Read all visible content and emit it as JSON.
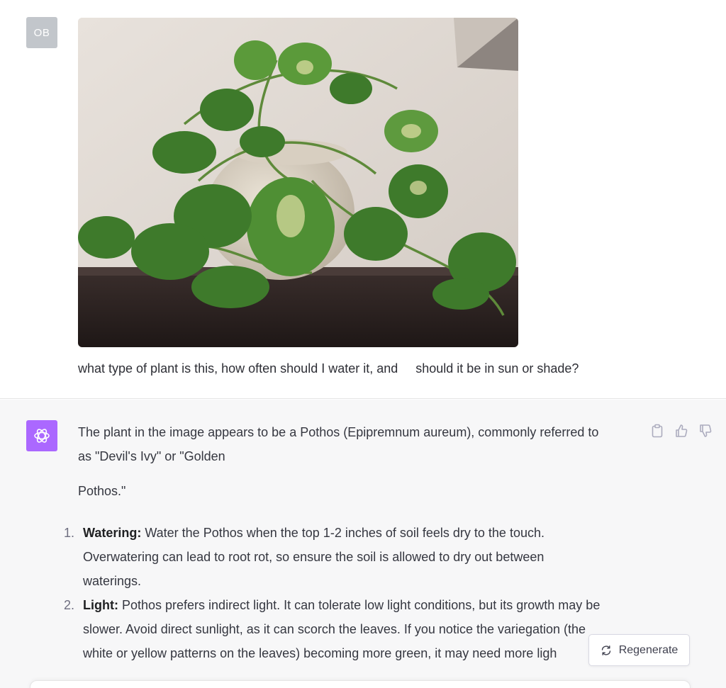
{
  "user": {
    "avatar_initials": "OB",
    "message": "what type of plant is this, how often should I water it, and     should it be in sun or shade?"
  },
  "assistant": {
    "intro_line1": "The plant in the image appears to be a Pothos (Epipremnum aureum), commonly referred to",
    "intro_line2": "as \"Devil's Ivy\" or \"Golden",
    "intro_line3": "Pothos.\"",
    "list": [
      {
        "num": "1.",
        "bold": "Watering:",
        "line1": " Water the Pothos when the top 1-2 inches of soil feels dry to the touch.",
        "line2": "Overwatering can lead to root rot, so ensure the soil is allowed to dry out between",
        "line3": "waterings."
      },
      {
        "num": "2.",
        "bold": "Light:",
        "line1": " Pothos prefers indirect light. It can tolerate low light conditions, but its growth may be",
        "line2": "slower. Avoid direct sunlight, as it can scorch the leaves. If you notice the variegation (the",
        "line3": "white or yellow patterns on the leaves) becoming more green, it may need more ligh"
      }
    ],
    "actions": [
      "clipboard-icon",
      "thumbs-up-icon",
      "thumbs-down-icon"
    ]
  },
  "regenerate_label": "Regenerate",
  "colors": {
    "bot_avatar": "#ab68ff",
    "user_avatar": "#c2c6cb",
    "assistant_bg": "#f7f7f8"
  }
}
